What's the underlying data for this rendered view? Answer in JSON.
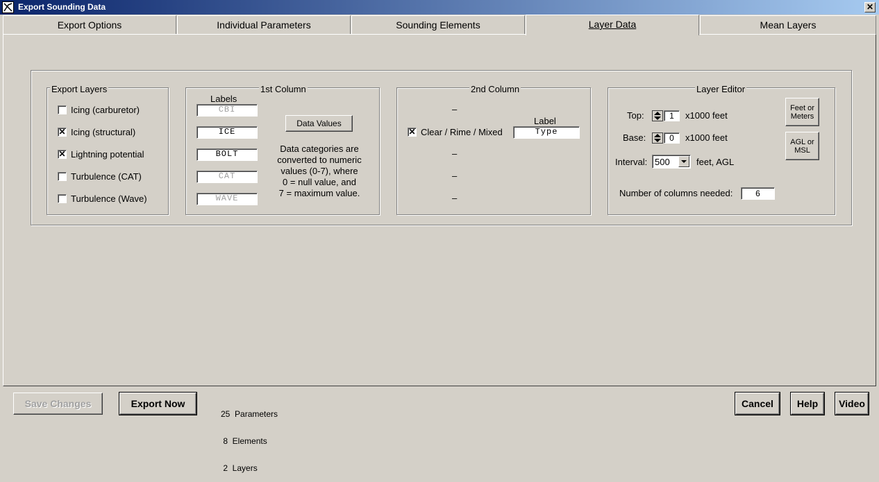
{
  "window": {
    "title": "Export Sounding Data",
    "close_glyph": "✕",
    "app_icon": "app-icon"
  },
  "tabs": [
    {
      "label": "Export Options",
      "active": false
    },
    {
      "label": "Individual Parameters",
      "active": false
    },
    {
      "label": "Sounding Elements",
      "active": false
    },
    {
      "label": "Layer Data",
      "active": true
    },
    {
      "label": "Mean Layers",
      "active": false
    }
  ],
  "export_layers": {
    "title": "Export Layers",
    "items": [
      {
        "label": "Icing (carburetor)",
        "checked": false
      },
      {
        "label": "Icing (structural)",
        "checked": true
      },
      {
        "label": "Lightning potential",
        "checked": true
      },
      {
        "label": "Turbulence (CAT)",
        "checked": false
      },
      {
        "label": "Turbulence (Wave)",
        "checked": false
      }
    ]
  },
  "first_column": {
    "title": "1st Column",
    "labels_header": "Labels",
    "fields": [
      {
        "value": "CBI",
        "enabled": false
      },
      {
        "value": "ICE",
        "enabled": true
      },
      {
        "value": "BOLT",
        "enabled": true
      },
      {
        "value": "CAT",
        "enabled": false
      },
      {
        "value": "WAVE",
        "enabled": false
      }
    ],
    "data_values_button": "Data Values",
    "note_lines": [
      "Data categories are",
      "converted to numeric",
      "values (0-7),  where",
      "0 = null value, and",
      "7 = maximum value."
    ]
  },
  "second_column": {
    "title": "2nd Column",
    "label_header": "Label",
    "dash": "–",
    "checkbox_label": "Clear / Rime / Mixed",
    "checkbox_checked": true,
    "type_field": "Type"
  },
  "layer_editor": {
    "title": "Layer Editor",
    "top_label": "Top:",
    "top_value": "1",
    "top_unit": "x1000 feet",
    "base_label": "Base:",
    "base_value": "0",
    "base_unit": "x1000 feet",
    "interval_label": "Interval:",
    "interval_value": "500",
    "interval_unit": "feet, AGL",
    "feet_meters_line1": "Feet or",
    "feet_meters_line2": "Meters",
    "agl_msl_line1": "AGL or",
    "agl_msl_line2": "MSL",
    "columns_label": "Number of columns needed:",
    "columns_value": "6"
  },
  "footer": {
    "save_button": "Save Changes",
    "export_button": "Export Now",
    "status_lines": [
      "25  Parameters",
      " 8  Elements",
      " 2  Layers"
    ],
    "cancel_button": "Cancel",
    "help_button": "Help",
    "video_button": "Video"
  }
}
